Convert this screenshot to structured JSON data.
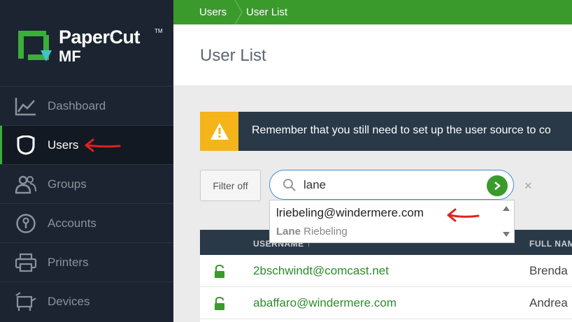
{
  "app": {
    "brand_line1": "PaperCut",
    "brand_line2": "MF",
    "brand_tm": "TM",
    "accent_color": "#3a9a2c",
    "sidebar_color": "#1b2430"
  },
  "sidebar": {
    "items": [
      {
        "label": "Dashboard",
        "icon": "dashboard-icon"
      },
      {
        "label": "Users",
        "icon": "users-icon",
        "active": true
      },
      {
        "label": "Groups",
        "icon": "groups-icon"
      },
      {
        "label": "Accounts",
        "icon": "accounts-icon"
      },
      {
        "label": "Printers",
        "icon": "printers-icon"
      },
      {
        "label": "Devices",
        "icon": "devices-icon"
      }
    ]
  },
  "breadcrumb": {
    "items": [
      "Users",
      "User List"
    ]
  },
  "page": {
    "title": "User List"
  },
  "alert": {
    "icon": "warning-icon",
    "text": "Remember that you still need to set up the user source to co"
  },
  "filter": {
    "button_label": "Filter off"
  },
  "search": {
    "value": "lane",
    "clear_label": "✕"
  },
  "suggestion": {
    "username": "lriebeling@windermere.com",
    "match": "Lane",
    "rest": " Riebeling"
  },
  "table": {
    "columns": [
      "USERNAME ↑",
      "FULL NAME"
    ],
    "rows": [
      {
        "username": "2bschwindt@comcast.net",
        "full_name": "Brenda"
      },
      {
        "username": "abaffaro@windermere.com",
        "full_name": "Andrea"
      }
    ]
  }
}
